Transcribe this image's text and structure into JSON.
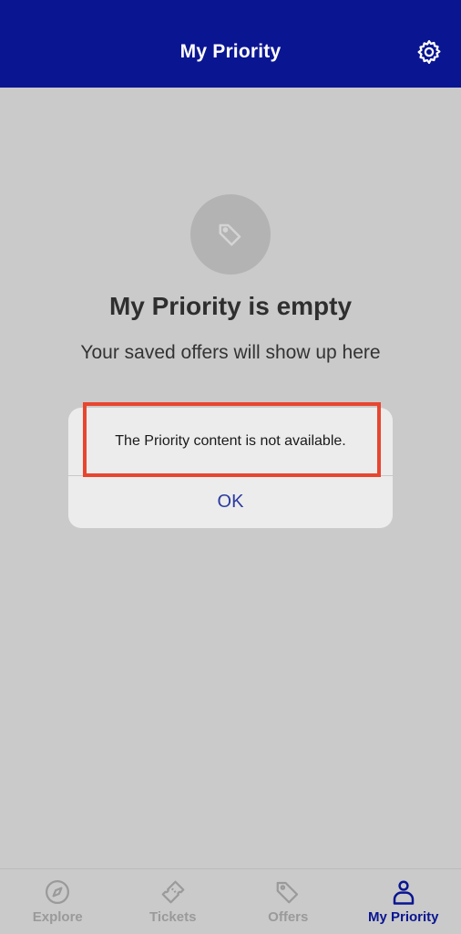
{
  "header": {
    "title": "My Priority",
    "settings_icon": "gear-icon"
  },
  "empty_state": {
    "icon": "tag-icon",
    "title": "My Priority is empty",
    "subtitle": "Your saved offers will show up here"
  },
  "alert": {
    "message": "The Priority content is not available.",
    "ok_label": "OK"
  },
  "tabs": [
    {
      "label": "Explore",
      "icon": "compass-icon",
      "active": false
    },
    {
      "label": "Tickets",
      "icon": "ticket-icon",
      "active": false
    },
    {
      "label": "Offers",
      "icon": "tag-icon",
      "active": false
    },
    {
      "label": "My Priority",
      "icon": "person-icon",
      "active": true
    }
  ],
  "colors": {
    "header_bg": "#0a1591",
    "accent": "#0a1591",
    "highlight": "#e8452f",
    "background": "#cacaca"
  }
}
